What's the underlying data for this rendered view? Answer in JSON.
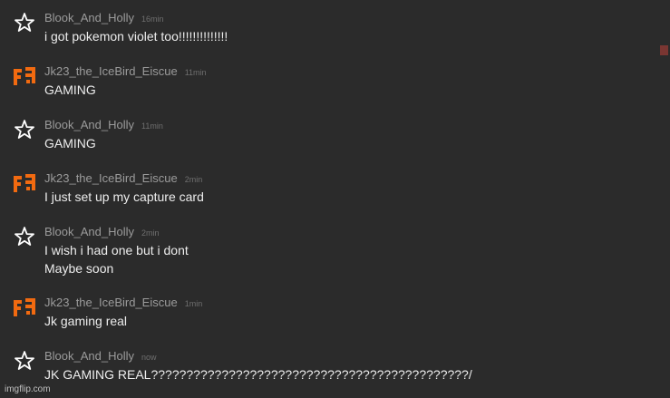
{
  "messages": [
    {
      "user": "Blook_And_Holly",
      "avatar": "star-icon",
      "time": "16min",
      "text": "i got pokemon violet too!!!!!!!!!!!!!!"
    },
    {
      "user": "Jk23_the_IceBird_Eiscue",
      "avatar": "orange-pixel-logo-icon",
      "time": "11min",
      "text": "GAMING"
    },
    {
      "user": "Blook_And_Holly",
      "avatar": "star-icon",
      "time": "11min",
      "text": "GAMING"
    },
    {
      "user": "Jk23_the_IceBird_Eiscue",
      "avatar": "orange-pixel-logo-icon",
      "time": "2min",
      "text": "I just set up my capture card"
    },
    {
      "user": "Blook_And_Holly",
      "avatar": "star-icon",
      "time": "2min",
      "text": "I wish i had one but i dont\nMaybe soon"
    },
    {
      "user": "Jk23_the_IceBird_Eiscue",
      "avatar": "orange-pixel-logo-icon",
      "time": "1min",
      "text": "Jk gaming real"
    },
    {
      "user": "Blook_And_Holly",
      "avatar": "star-icon",
      "time": "now",
      "text": "JK GAMING REAL?????????????????????????????????????????????/"
    }
  ],
  "colors": {
    "background": "#2b2b2b",
    "username": "#9b9b9b",
    "timestamp": "#6f6f6f",
    "message_text": "#ededed",
    "avatar_orange": "#f26a10",
    "scroll_marker": "#7a3632"
  },
  "watermark": "imgflip.com"
}
